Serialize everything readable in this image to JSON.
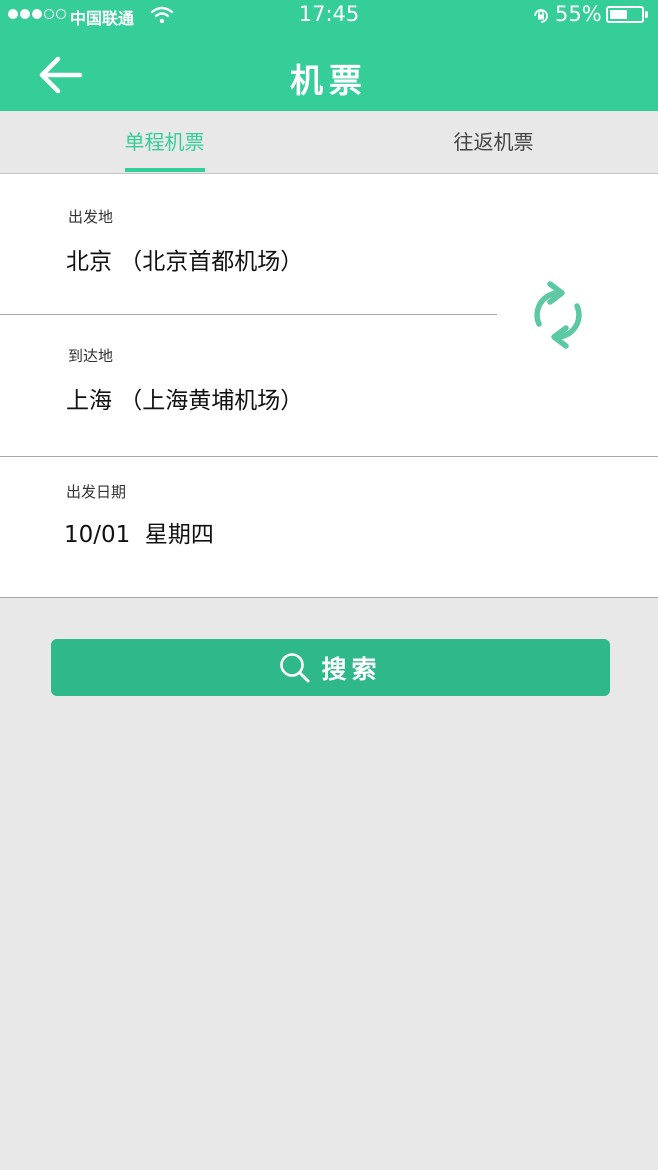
{
  "status_bar": {
    "signal_dots_filled": 3,
    "signal_dots_total": 5,
    "carrier": "中国联通",
    "time": "17:45",
    "battery_percent_text": "55%",
    "battery_level": 0.55,
    "icons": [
      "wifi-icon",
      "rotation-lock-icon",
      "battery-icon"
    ]
  },
  "header": {
    "title": "机票",
    "back_icon": "arrow-left-icon",
    "color": "#36ce98"
  },
  "tabs": {
    "items": [
      {
        "label": "单程机票",
        "active": true
      },
      {
        "label": "往返机票",
        "active": false
      }
    ],
    "active_color": "#36ce98"
  },
  "form": {
    "departure": {
      "label": "出发地",
      "value": "北京 （北京首都机场）"
    },
    "arrival": {
      "label": "到达地",
      "value": "上海 （上海黄埔机场）"
    },
    "date": {
      "label": "出发日期",
      "value": "10/01  星期四"
    },
    "swap_icon": "swap-refresh-icon"
  },
  "search": {
    "label": "搜索",
    "icon": "search-icon",
    "color": "#2fb889"
  }
}
